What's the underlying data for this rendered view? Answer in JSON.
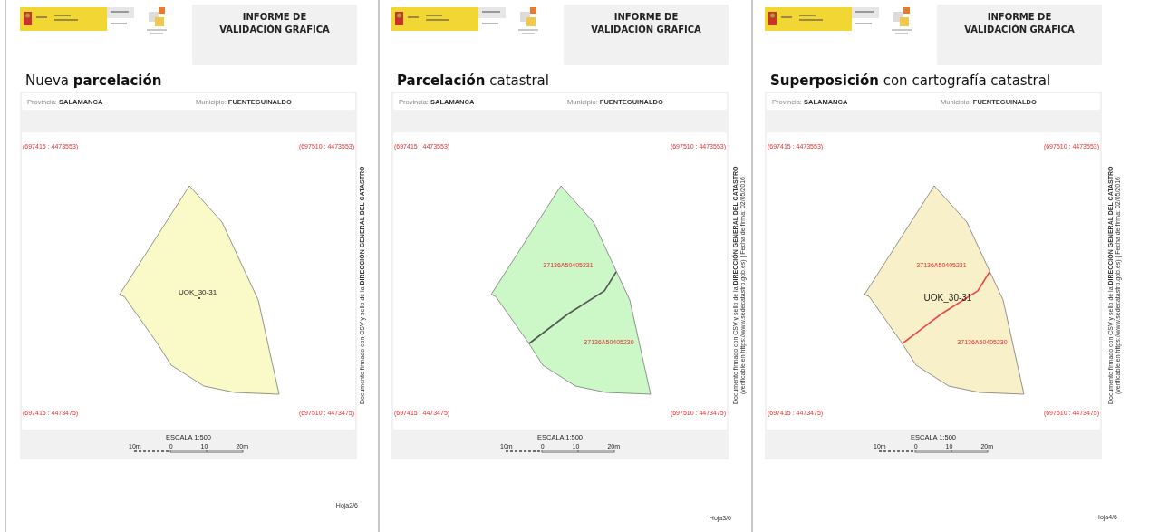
{
  "pages": [
    {
      "header_title": "INFORME DE\nVALIDACIÓN GRAFICA",
      "heading": "Nueva **parcelación**",
      "provincia": "Provincia: **SALAMANCA**",
      "municipio": "Municipio: **FUENTEGUINALDO**",
      "map": {
        "color": "#fafac8",
        "corners": [
          "(697415 : 4473553)",
          "(697510 : 4473553)",
          "(697415 : 4473475)",
          "(697510 : 4473475)"
        ],
        "labels": [
          {
            "kind": "point",
            "text": "UOK_30-31"
          }
        ]
      },
      "scale": {
        "title": "ESCALA 1:500",
        "ticks": [
          "10m",
          "0",
          "10",
          "20m"
        ]
      },
      "side_note": [
        "Documento firmado con CSV y sello de la **DIRECCIÓN GENERAL DEL CATASTRO**"
      ],
      "sheet": "Hoja2/6"
    },
    {
      "header_title": "INFORME DE\nVALIDACIÓN GRAFICA",
      "heading": "**Parcelación** catastral",
      "provincia": "Provincia: **SALAMANCA**",
      "municipio": "Municipio: **FUENTEGUINALDO**",
      "map": {
        "color": "#ccf8c8",
        "boundaries": [
          {
            "color": "#555555"
          }
        ],
        "corners": [
          "(697415 : 4473553)",
          "(697510 : 4473553)",
          "(697415 : 4473475)",
          "(697510 : 4473475)"
        ],
        "labels": [
          {
            "kind": "parcel",
            "text": "37136A50405231"
          },
          {
            "kind": "parcel",
            "text": "37136A50405230"
          }
        ]
      },
      "scale": {
        "title": "ESCALA 1:500",
        "ticks": [
          "10m",
          "0",
          "10",
          "20m"
        ]
      },
      "side_note": [
        "Documento firmado con CSV y sello de la **DIRECCIÓN GENERAL DEL CATASTRO**",
        "(verificable en https://www.sedecatastro.gob.es) | Fecha de firma: 02/05/2016"
      ],
      "sheet": "Hoja3/6"
    },
    {
      "header_title": "INFORME DE\nVALIDACIÓN GRAFICA",
      "heading": "**Superposición** con cartografía catastral",
      "provincia": "Provincia: **SALAMANCA**",
      "municipio": "Municipio: **FUENTEGUINALDO**",
      "map": {
        "color": "#f8f0c8",
        "boundaries": [
          {
            "color": "#e84a4a"
          }
        ],
        "corners": [
          "(697415 : 4473553)",
          "(697510 : 4473553)",
          "(697415 : 4473475)",
          "(697510 : 4473475)"
        ],
        "labels": [
          {
            "kind": "parcel",
            "text": "37136A50405231"
          },
          {
            "kind": "new",
            "text": "UOK_30-31"
          },
          {
            "kind": "parcel",
            "text": "37136A50405230"
          }
        ]
      },
      "scale": {
        "title": "ESCALA 1:500",
        "ticks": [
          "10m",
          "0",
          "10",
          "20m"
        ]
      },
      "side_note": [
        "Documento firmado con CSV y sello de la **DIRECCIÓN GENERAL DEL CATASTRO**",
        "(verificable en https://www.sedecatastro.gob.es) | Fecha de firma: 02/05/2016"
      ],
      "sheet": "Hoja4/6"
    }
  ]
}
